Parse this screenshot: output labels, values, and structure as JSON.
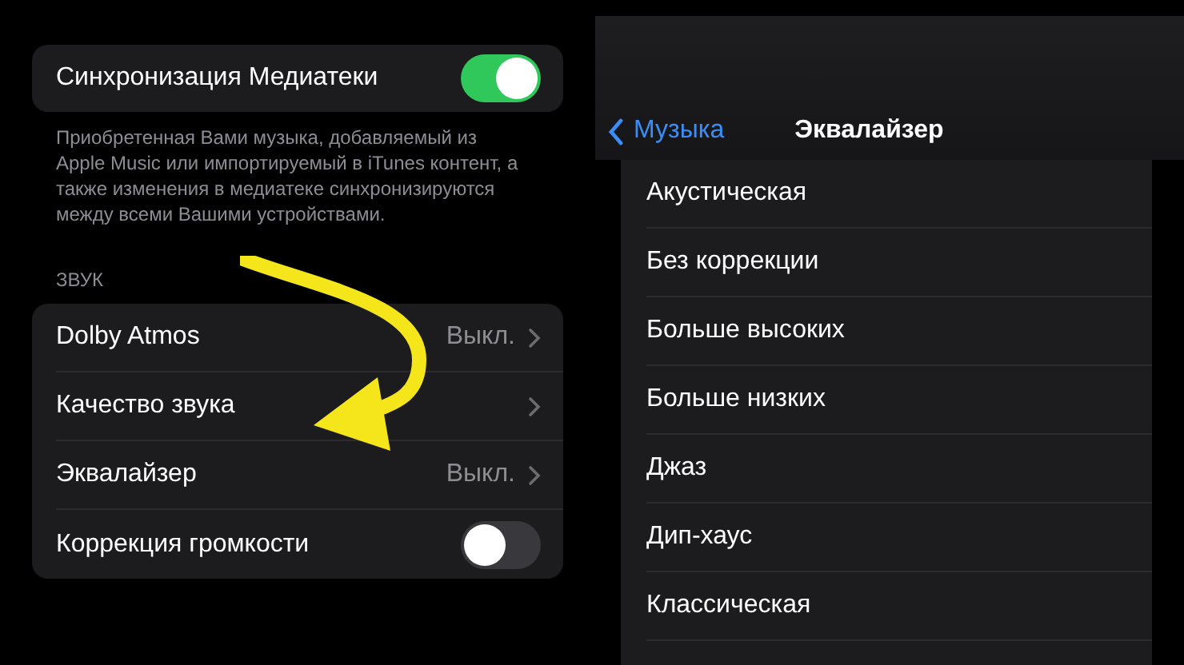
{
  "library_sync": {
    "label": "Синхронизация Медиатеки",
    "on": true
  },
  "sync_description": "Приобретенная Вами музыка, добавляемый из Apple Music или импортируемый в iTunes контент, а также изменения в медиатеке синхронизируются между всеми Вашими устройствами.",
  "sound_section": {
    "header": "ЗВУК",
    "rows": [
      {
        "kind": "link",
        "label": "Dolby Atmos",
        "value": "Выкл."
      },
      {
        "kind": "link",
        "label": "Качество звука"
      },
      {
        "kind": "link",
        "label": "Эквалайзер",
        "value": "Выкл."
      },
      {
        "kind": "toggle",
        "label": "Коррекция громкости",
        "on": false
      }
    ]
  },
  "equalizer": {
    "back": "Музыка",
    "title": "Эквалайзер",
    "options": [
      "Акустическая",
      "Без коррекции",
      "Больше высоких",
      "Больше низких",
      "Джаз",
      "Дип-хаус",
      "Классическая"
    ]
  }
}
